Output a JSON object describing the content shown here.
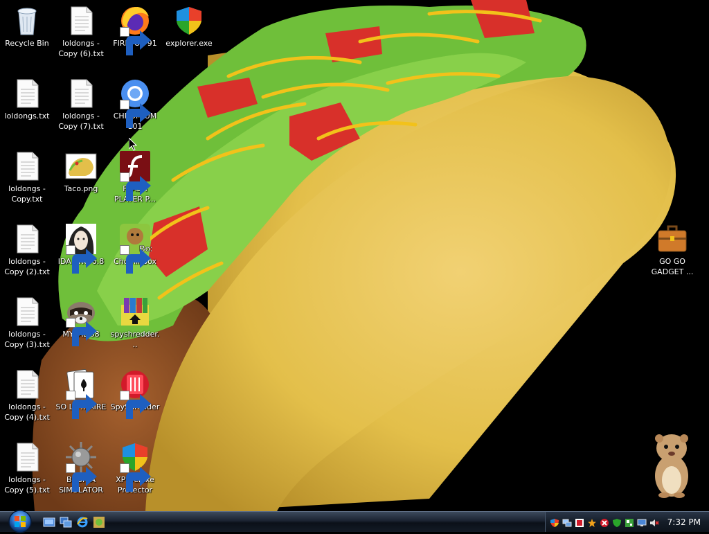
{
  "desktop": {
    "icons": [
      {
        "label": "Recycle Bin",
        "icon": "recycle-bin-icon",
        "shortcut": false
      },
      {
        "label": "loldongs - Copy (6).txt",
        "icon": "text-file-icon",
        "shortcut": false
      },
      {
        "label": "FIREFOX 91",
        "icon": "firefox-icon",
        "shortcut": true
      },
      {
        "label": "explorer.exe",
        "icon": "shield-icon",
        "shortcut": false
      },
      {
        "label": "loldongs.txt",
        "icon": "text-file-icon",
        "shortcut": false
      },
      {
        "label": "loldongs - Copy (7).txt",
        "icon": "text-file-icon",
        "shortcut": false
      },
      {
        "label": "CHROMIUM 101",
        "icon": "chromium-icon",
        "shortcut": true
      },
      {
        "label": "loldongs - Copy.txt",
        "icon": "text-file-icon",
        "shortcut": false
      },
      {
        "label": "Taco.png",
        "icon": "image-file-icon",
        "shortcut": false
      },
      {
        "label": "FLASH PLAYER P...",
        "icon": "flash-player-icon",
        "shortcut": true
      },
      {
        "label": "loldongs - Copy (2).txt",
        "icon": "text-file-icon",
        "shortcut": false
      },
      {
        "label": "IDA PRO 6.8",
        "icon": "ida-pro-icon",
        "shortcut": true
      },
      {
        "label": "ChomikBox",
        "icon": "chomikbox-icon",
        "shortcut": true
      },
      {
        "label": "loldongs - Copy (3).txt",
        "icon": "text-file-icon",
        "shortcut": false
      },
      {
        "label": "MYPAL 68",
        "icon": "raccoon-icon",
        "shortcut": true
      },
      {
        "label": "spyshredder...",
        "icon": "archive-installer-icon",
        "shortcut": false
      },
      {
        "label": "loldongs - Copy (4).txt",
        "icon": "text-file-icon",
        "shortcut": false
      },
      {
        "label": "SO LIT!! AIRE",
        "icon": "solitaire-icon",
        "shortcut": true
      },
      {
        "label": "SpyShredder",
        "icon": "spyshredder-icon",
        "shortcut": true
      },
      {
        "label": "loldongs - Copy (5).txt",
        "icon": "text-file-icon",
        "shortcut": false
      },
      {
        "label": "BOSNIA SIMULATOR",
        "icon": "spiked-mine-icon",
        "shortcut": true
      },
      {
        "label": "XP Deluxe Protector",
        "icon": "shield-icon",
        "shortcut": true
      },
      {
        "label": "GO GO GADGET ...",
        "icon": "briefcase-icon",
        "shortcut": false
      }
    ]
  },
  "taskbar": {
    "quick_launch": [
      "show-desktop-icon",
      "switch-windows-icon",
      "internet-explorer-icon",
      "media-icon"
    ],
    "tray_icons": [
      "security-shield-icon",
      "network-icon",
      "antivirus-icon",
      "star-icon",
      "stop-icon",
      "green-shield-icon",
      "update-icon",
      "monitor-icon",
      "volume-muted-icon"
    ],
    "clock": "7:32 PM"
  },
  "colors": {
    "desktop_background": "#000000",
    "taco_shell": "#e3bf4a",
    "lettuce": "#6fbf3a",
    "tomato": "#d8302a",
    "cheese": "#f2c21a",
    "label_text": "#ffffff"
  }
}
